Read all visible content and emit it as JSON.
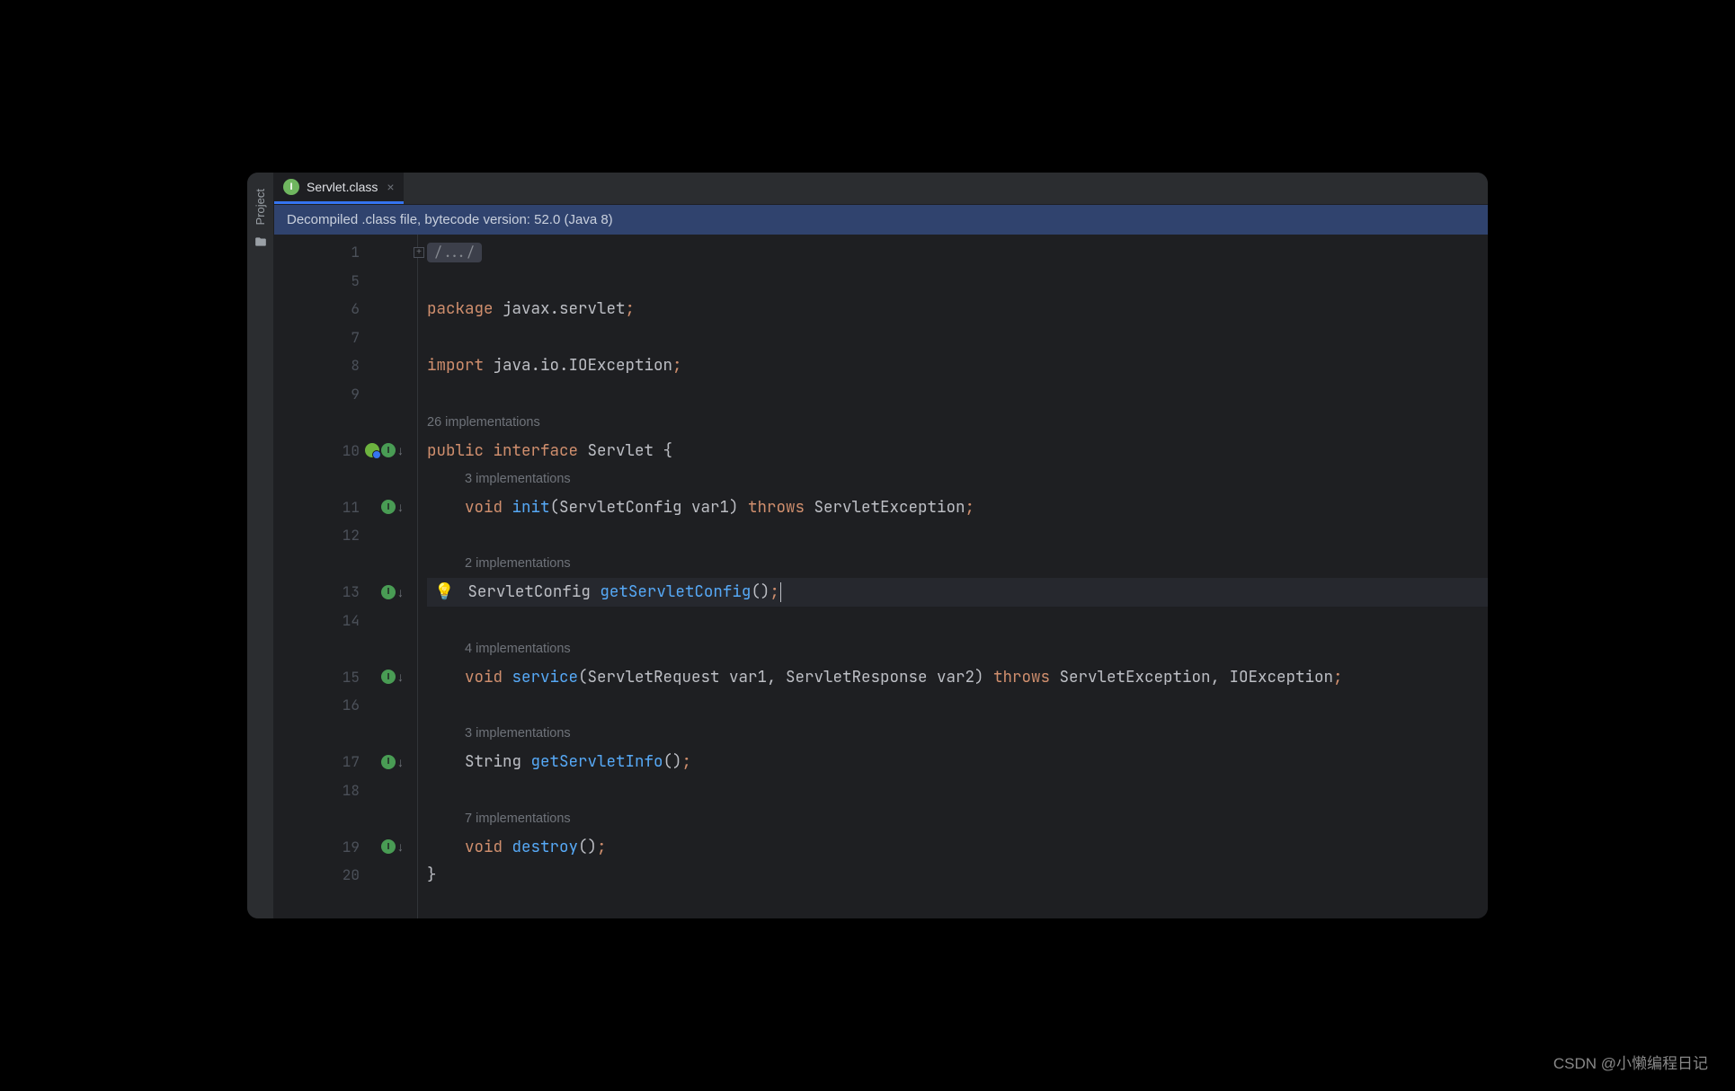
{
  "sidebar": {
    "project_label": "Project"
  },
  "tab": {
    "icon_letter": "I",
    "filename": "Servlet.class"
  },
  "info_bar": "Decompiled .class file, bytecode version: 52.0 (Java 8)",
  "lines": [
    "1",
    "5",
    "6",
    "7",
    "8",
    "9",
    "10",
    "11",
    "12",
    "13",
    "14",
    "15",
    "16",
    "17",
    "18",
    "19",
    "20"
  ],
  "code": {
    "folded": "/.../",
    "package_kw": "package ",
    "package_val": "javax.servlet",
    "import_kw": "import ",
    "import_val": "java.io.IOException",
    "impl_26": "26 implementations",
    "public_interface": "public interface ",
    "interface_name": "Servlet",
    "brace_open": " {",
    "impl_3a": "3 implementations",
    "void_kw": "void ",
    "init_method": "init",
    "init_params": "(ServletConfig var1) ",
    "throws_kw": "throws ",
    "init_ex": "ServletException",
    "impl_2": "2 implementations",
    "sc_type": "ServletConfig ",
    "getsc_method": "getServletConfig",
    "empty_params": "()",
    "impl_4": "4 implementations",
    "service_method": "service",
    "service_params": "(ServletRequest var1, ServletResponse var2) ",
    "service_ex": "ServletException, IOException",
    "impl_3b": "3 implementations",
    "string_type": "String ",
    "getinfo_method": "getServletInfo",
    "impl_7": "7 implementations",
    "destroy_method": "destroy",
    "brace_close": "}",
    "semi": ";"
  },
  "watermark": "CSDN @小懒编程日记"
}
